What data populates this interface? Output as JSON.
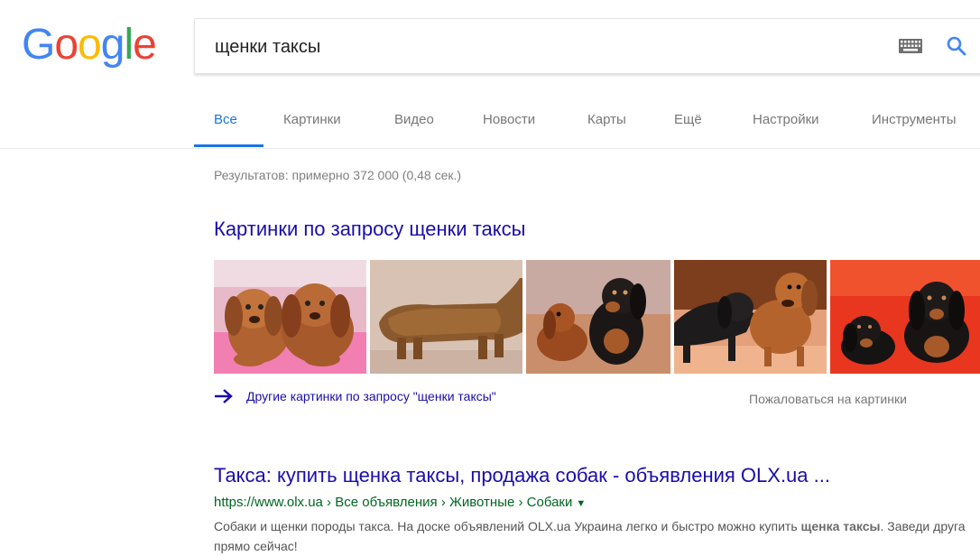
{
  "logo": {
    "letters": [
      "G",
      "o",
      "o",
      "g",
      "l",
      "e"
    ],
    "colors": [
      "#4285f4",
      "#ea4335",
      "#fbbc05",
      "#4285f4",
      "#34a853",
      "#ea4335"
    ]
  },
  "search": {
    "query": "щенки таксы"
  },
  "tabs": [
    {
      "label": "Все",
      "active": true
    },
    {
      "label": "Картинки"
    },
    {
      "label": "Видео"
    },
    {
      "label": "Новости"
    },
    {
      "label": "Карты"
    },
    {
      "label": "Ещё"
    },
    {
      "label": "Настройки"
    },
    {
      "label": "Инструменты"
    }
  ],
  "stats": "Результатов: примерно 372 000 (0,48 сек.)",
  "images": {
    "heading": "Картинки по запросу щенки таксы",
    "more_link": "Другие картинки по запросу \"щенки таксы\"",
    "report": "Пожаловаться на картинки"
  },
  "result": {
    "title": "Такса: купить щенка таксы, продажа собак - объявления OLX.ua ...",
    "url": "https://www.olx.ua › Все объявления › Животные › Собаки",
    "snippet_pre": "Собаки и щенки породы такса. На доске объявлений OLX.ua Украина легко и быстро можно купить ",
    "snippet_bold": "щенка таксы",
    "snippet_post": ". Заведи друга прямо сейчас!"
  },
  "colors": {
    "link": "#1a0dab",
    "url": "#006621",
    "accent": "#1a73e8"
  }
}
